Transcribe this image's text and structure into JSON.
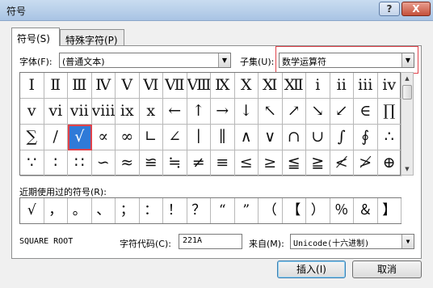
{
  "window": {
    "title": "符号",
    "help": "?",
    "close": "X"
  },
  "tabs": [
    {
      "label": "符号(S)"
    },
    {
      "label": "特殊字符(P)"
    }
  ],
  "font": {
    "label": "字体(F):",
    "value": "(普通文本)"
  },
  "subset": {
    "label": "子集(U):",
    "value": "数学运算符"
  },
  "symbols": [
    [
      "Ⅰ",
      "Ⅱ",
      "Ⅲ",
      "Ⅳ",
      "Ⅴ",
      "Ⅵ",
      "Ⅶ",
      "Ⅷ",
      "Ⅸ",
      "Ⅹ",
      "Ⅺ",
      "Ⅻ",
      "ⅰ",
      "ⅱ",
      "ⅲ",
      "ⅳ"
    ],
    [
      "ⅴ",
      "ⅵ",
      "ⅶ",
      "ⅷ",
      "ⅸ",
      "ⅹ",
      "←",
      "↑",
      "→",
      "↓",
      "↖",
      "↗",
      "↘",
      "↙",
      "∈",
      "∏"
    ],
    [
      "∑",
      "∕",
      "√",
      "∝",
      "∞",
      "∟",
      "∠",
      "∣",
      "∥",
      "∧",
      "∨",
      "∩",
      "∪",
      "∫",
      "∮",
      "∴"
    ],
    [
      "∵",
      "∶",
      "∷",
      "∽",
      "≈",
      "≌",
      "≒",
      "≠",
      "≡",
      "≤",
      "≥",
      "≦",
      "≧",
      "≮",
      "≯",
      "⊕"
    ]
  ],
  "selected_symbol": "√",
  "recent": {
    "label": "近期使用过的符号(R):",
    "items": [
      "√",
      "，",
      "。",
      "、",
      "；",
      "：",
      "！",
      "？",
      "“",
      "”",
      "（",
      "【",
      "）",
      "％",
      "＆",
      "】"
    ]
  },
  "char_name": "SQUARE ROOT",
  "char_code": {
    "label": "字符代码(C):",
    "value": "221A"
  },
  "from": {
    "label": "来自(M):",
    "value": "Unicode(十六进制)"
  },
  "buttons": {
    "insert": "插入(I)",
    "cancel": "取消"
  },
  "colors": {
    "highlight": "#e0424a",
    "selection": "#2f7ad8"
  }
}
